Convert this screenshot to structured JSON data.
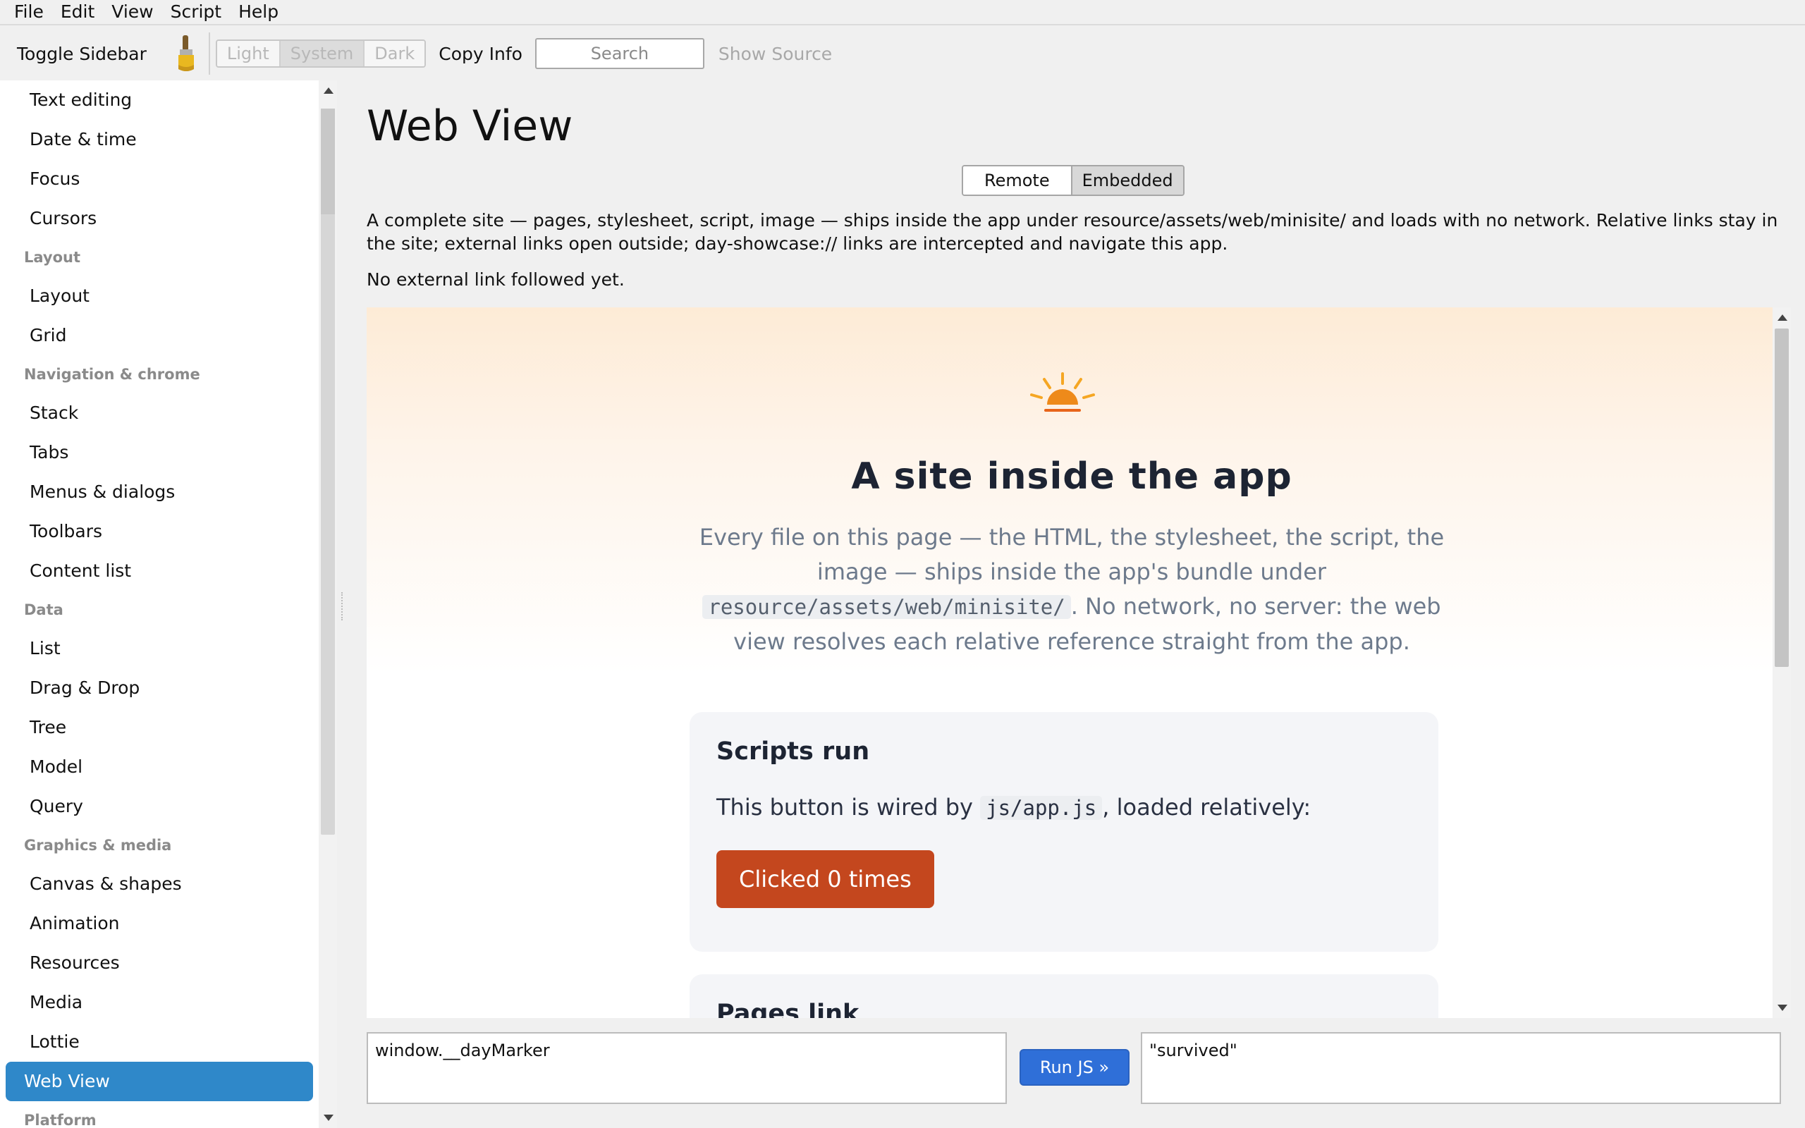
{
  "menubar": [
    "File",
    "Edit",
    "View",
    "Script",
    "Help"
  ],
  "toolbar": {
    "toggle_sidebar": "Toggle Sidebar",
    "theme_options": [
      "Light",
      "System",
      "Dark"
    ],
    "theme_selected": "System",
    "copy_info": "Copy Info",
    "search_placeholder": "Search",
    "show_source": "Show Source"
  },
  "sidebar": {
    "entries": [
      {
        "kind": "item",
        "label": "Text editing"
      },
      {
        "kind": "item",
        "label": "Date & time"
      },
      {
        "kind": "item",
        "label": "Focus"
      },
      {
        "kind": "item",
        "label": "Cursors"
      },
      {
        "kind": "section",
        "label": "Layout"
      },
      {
        "kind": "item",
        "label": "Layout"
      },
      {
        "kind": "item",
        "label": "Grid"
      },
      {
        "kind": "section",
        "label": "Navigation & chrome"
      },
      {
        "kind": "item",
        "label": "Stack"
      },
      {
        "kind": "item",
        "label": "Tabs"
      },
      {
        "kind": "item",
        "label": "Menus & dialogs"
      },
      {
        "kind": "item",
        "label": "Toolbars"
      },
      {
        "kind": "item",
        "label": "Content list"
      },
      {
        "kind": "section",
        "label": "Data"
      },
      {
        "kind": "item",
        "label": "List"
      },
      {
        "kind": "item",
        "label": "Drag & Drop"
      },
      {
        "kind": "item",
        "label": "Tree"
      },
      {
        "kind": "item",
        "label": "Model"
      },
      {
        "kind": "item",
        "label": "Query"
      },
      {
        "kind": "section",
        "label": "Graphics & media"
      },
      {
        "kind": "item",
        "label": "Canvas & shapes"
      },
      {
        "kind": "item",
        "label": "Animation"
      },
      {
        "kind": "item",
        "label": "Resources"
      },
      {
        "kind": "item",
        "label": "Media"
      },
      {
        "kind": "item",
        "label": "Lottie"
      },
      {
        "kind": "item",
        "label": "Web View",
        "active": true
      },
      {
        "kind": "section",
        "label": "Platform"
      }
    ]
  },
  "main": {
    "title": "Web View",
    "modes": [
      "Remote",
      "Embedded"
    ],
    "mode_selected": "Embedded",
    "description": "A complete site — pages, stylesheet, script, image — ships inside the app under resource/assets/web/minisite/ and loads with no network. Relative links stay in the site; external links open outside; day-showcase:// links are intercepted and navigate this app.",
    "external_status": "No external link followed yet."
  },
  "webview": {
    "title": "A site inside the app",
    "lead_part1": "Every file on this page — the HTML, the stylesheet, the script, the image — ships inside the app's bundle under",
    "lead_code": "resource/assets/web/minisite/",
    "lead_part2": ". No network, no server: the web view resolves each relative reference straight from the app.",
    "card1": {
      "heading": "Scripts run",
      "text_before": "This button is wired by",
      "code": "js/app.js",
      "text_after": ", loaded relatively:",
      "button": "Clicked 0 times"
    },
    "card2": {
      "heading": "Pages link"
    }
  },
  "console": {
    "input_value": "window.__dayMarker",
    "run_label": "Run JS »",
    "output": "\"survived\""
  },
  "colors": {
    "accent": "#2f88c9",
    "run_button": "#2f6fd8",
    "site_button": "#c4471e",
    "sun": "#f5a623"
  }
}
